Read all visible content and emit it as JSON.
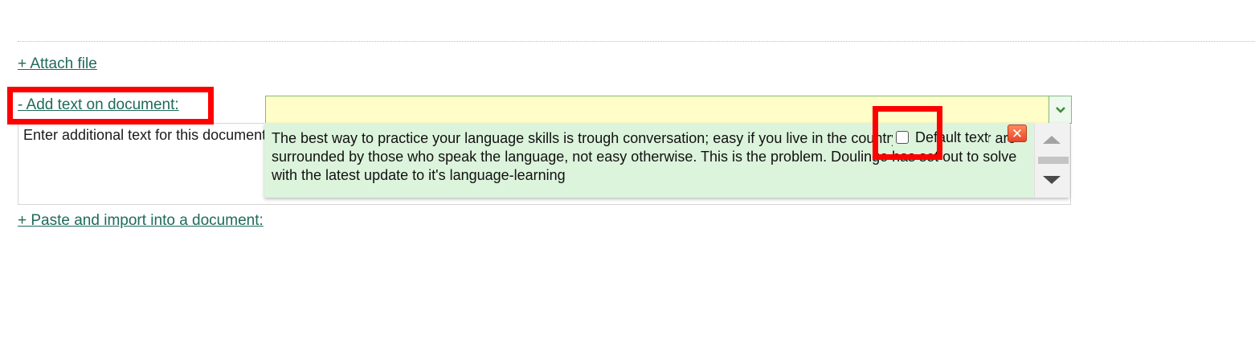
{
  "links": {
    "attach_file": "+ Attach file",
    "add_text": "- Add text on document:",
    "paste_import": "+ Paste and import into a document:"
  },
  "text_area": {
    "placeholder": "Enter additional text for this document"
  },
  "dropdown": {
    "expand_icon": "chevron-down-icon",
    "option_text": "The best way to practice your language skills is trough conversation; easy if you live in the country concerned, or are surrounded by those who speak the language, not easy otherwise. This is the problem. Doulingo has set out to solve with the latest update to it's language-learning",
    "default_checkbox_label": "Default text",
    "default_checked": false,
    "close_icon": "close-icon"
  },
  "colors": {
    "link": "#1e6b5a",
    "highlight": "#ff0000",
    "select_bg": "#fffdc8",
    "dropdown_bg": "#dcf3dc",
    "close_button": "#e8452a"
  }
}
